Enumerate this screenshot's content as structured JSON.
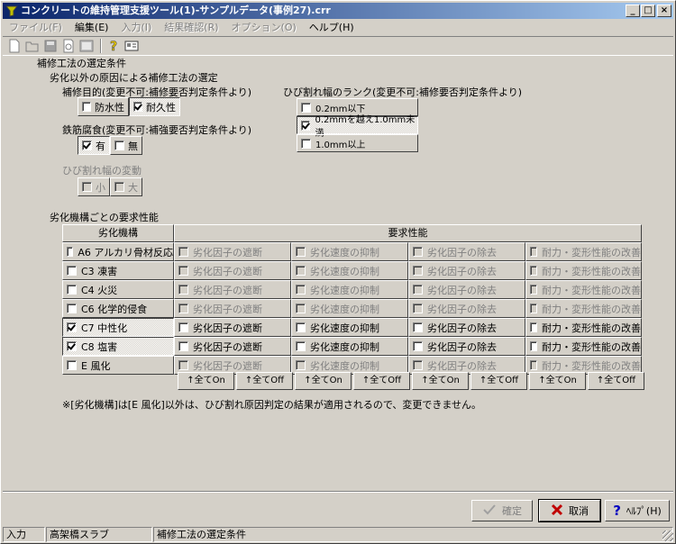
{
  "window": {
    "title": "コンクリートの維持管理支援ツール(1)-サンプルデータ(事例27).crr",
    "minimize": "_",
    "maximize": "□",
    "close": "×"
  },
  "menu": [
    "ファイル(F)",
    "編集(E)",
    "入力(I)",
    "結果確認(R)",
    "オプション(O)",
    "ヘルプ(H)"
  ],
  "section_title": "補修工法の選定条件",
  "subsection_title": "劣化以外の原因による補修工法の選定",
  "purpose": {
    "label": "補修目的(変更不可:補修要否判定条件より)",
    "options": [
      {
        "label": "防水性",
        "checked": false
      },
      {
        "label": "耐久性",
        "checked": true
      }
    ]
  },
  "corrosion": {
    "label": "鉄筋腐食(変更不可:補強要否判定条件より)",
    "options": [
      {
        "label": "有",
        "checked": true
      },
      {
        "label": "無",
        "checked": false
      }
    ]
  },
  "crack_movement": {
    "label": "ひび割れ幅の変動",
    "options": [
      {
        "label": "小",
        "checked": false
      },
      {
        "label": "大",
        "checked": false
      }
    ]
  },
  "crack_rank": {
    "label": "ひび割れ幅のランク(変更不可:補修要否判定条件より)",
    "options": [
      {
        "label": "0.2mm以下",
        "checked": false
      },
      {
        "label": "0.2mmを越え1.0mm未満",
        "checked": true
      },
      {
        "label": "1.0mm以上",
        "checked": false
      }
    ]
  },
  "perf_title": "劣化機構ごとの要求性能",
  "table": {
    "col_mechanism": "劣化機構",
    "col_perf": "要求性能",
    "rows": [
      {
        "mechanism": "A6 アルカリ骨材反応",
        "checked": false,
        "enabled": false,
        "perf": [
          "劣化因子の遮断",
          "劣化速度の抑制",
          "劣化因子の除去",
          "耐力・変形性能の改善"
        ]
      },
      {
        "mechanism": "C3 凍害",
        "checked": false,
        "enabled": false,
        "perf": [
          "劣化因子の遮断",
          "劣化速度の抑制",
          "劣化因子の除去",
          "耐力・変形性能の改善"
        ]
      },
      {
        "mechanism": "C4 火災",
        "checked": false,
        "enabled": false,
        "perf": [
          "劣化因子の遮断",
          "劣化速度の抑制",
          "劣化因子の除去",
          "耐力・変形性能の改善"
        ]
      },
      {
        "mechanism": "C6 化学的侵食",
        "checked": false,
        "enabled": false,
        "perf": [
          "劣化因子の遮断",
          "劣化速度の抑制",
          "劣化因子の除去",
          "耐力・変形性能の改善"
        ]
      },
      {
        "mechanism": "C7 中性化",
        "checked": true,
        "enabled": true,
        "perf": [
          "劣化因子の遮断",
          "劣化速度の抑制",
          "劣化因子の除去",
          "耐力・変形性能の改善"
        ]
      },
      {
        "mechanism": "C8 塩害",
        "checked": true,
        "enabled": true,
        "perf": [
          "劣化因子の遮断",
          "劣化速度の抑制",
          "劣化因子の除去",
          "耐力・変形性能の改善"
        ]
      },
      {
        "mechanism": "E 風化",
        "checked": false,
        "enabled": false,
        "perf": [
          "劣化因子の遮断",
          "劣化速度の抑制",
          "劣化因子の除去",
          "耐力・変形性能の改善"
        ]
      }
    ],
    "all_buttons": [
      "↑全てOn",
      "↑全てOff",
      "↑全てOn",
      "↑全てOff",
      "↑全てOn",
      "↑全てOff",
      "↑全てOn",
      "↑全てOff"
    ]
  },
  "note": "※[劣化機構]は[E 風化]以外は、ひび割れ原因判定の結果が適用されるので、変更できません。",
  "buttons": {
    "ok": "確定",
    "cancel": "取消",
    "help": "ﾍﾙﾌﾟ(H)"
  },
  "status": [
    "入力",
    "高架橋スラブ",
    "補修工法の選定条件"
  ],
  "colors": {
    "title_start": "#0a246a",
    "title_end": "#a6caf0",
    "face": "#d4d0c8"
  }
}
